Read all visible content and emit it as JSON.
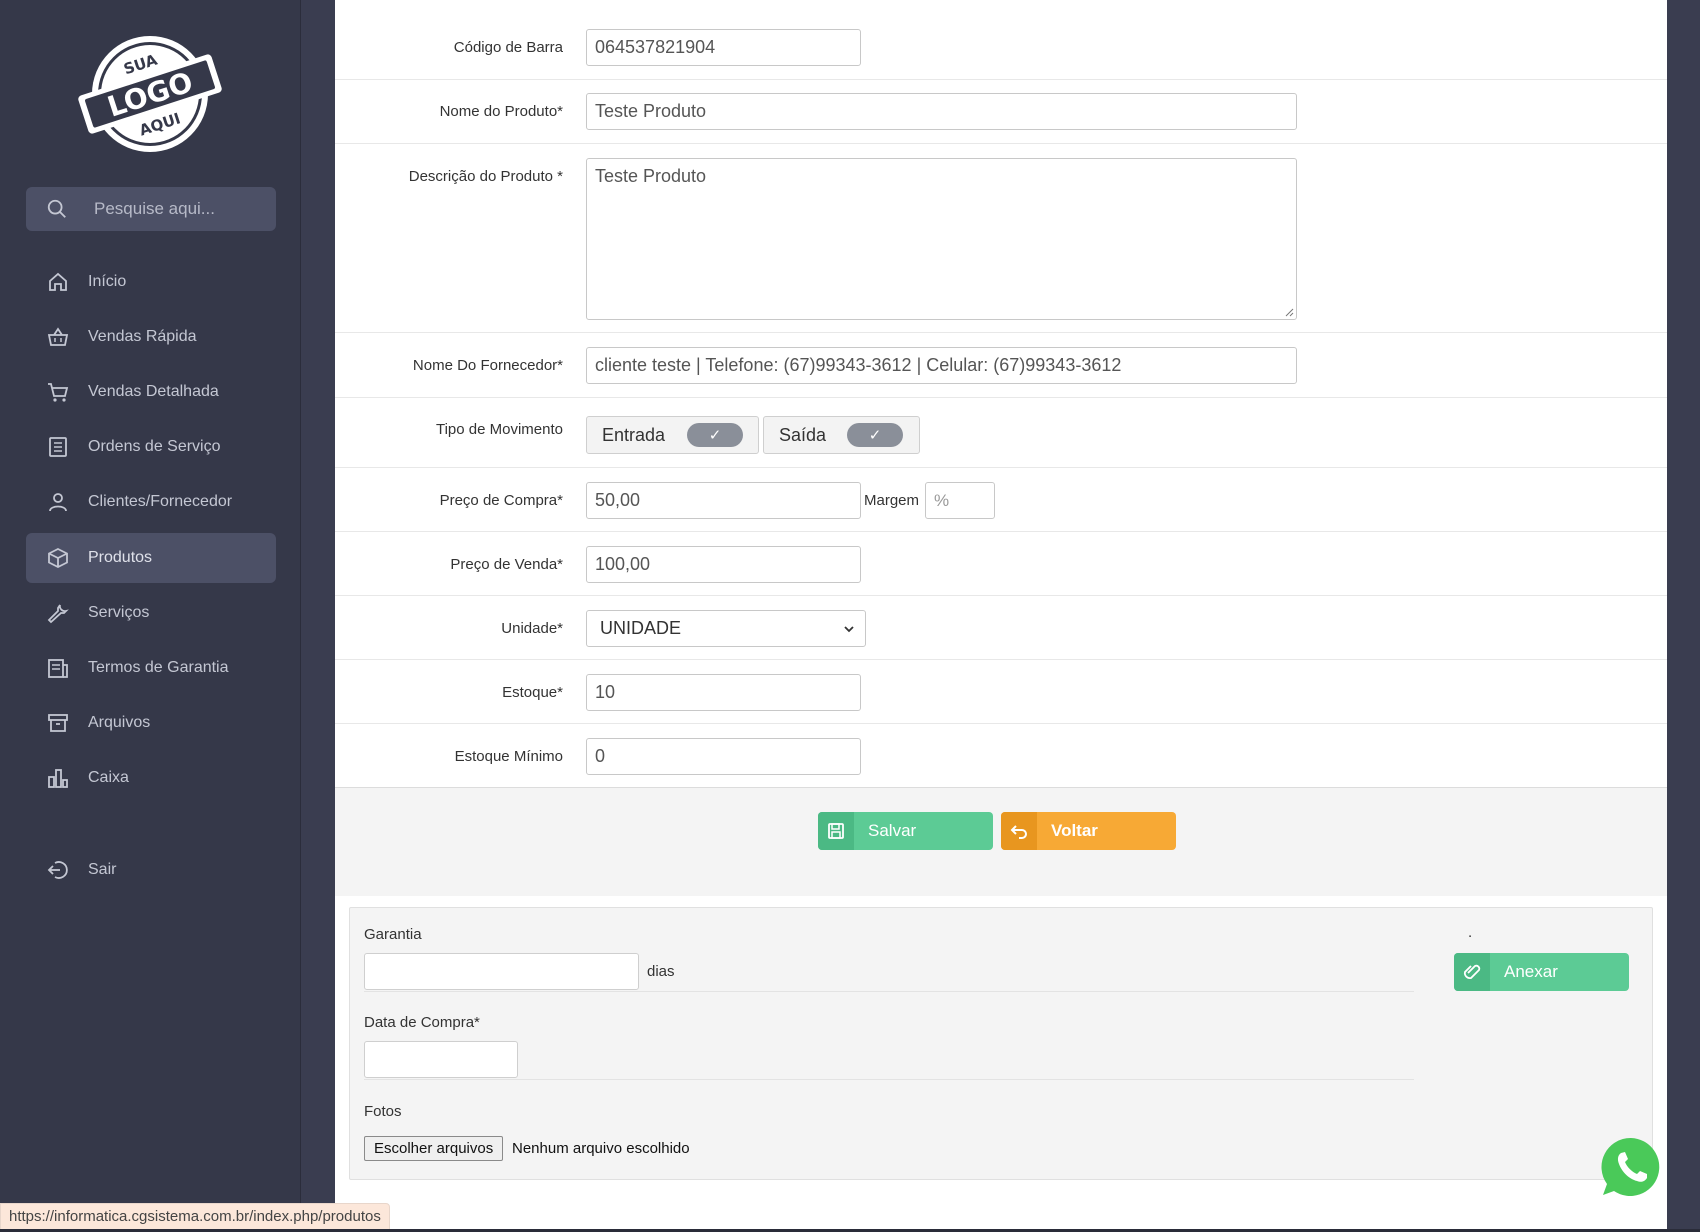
{
  "logo": {
    "line1": "SUA",
    "line2": "LOGO",
    "line3": "AQUI"
  },
  "search": {
    "placeholder": "Pesquise aqui..."
  },
  "sidebar": {
    "items": [
      {
        "label": "Início",
        "icon": "home-icon"
      },
      {
        "label": "Vendas Rápida",
        "icon": "basket-icon"
      },
      {
        "label": "Vendas Detalhada",
        "icon": "cart-icon"
      },
      {
        "label": "Ordens de Serviço",
        "icon": "list-icon"
      },
      {
        "label": "Clientes/Fornecedor",
        "icon": "user-icon"
      },
      {
        "label": "Produtos",
        "icon": "box-icon",
        "active": true
      },
      {
        "label": "Serviços",
        "icon": "wrench-icon"
      },
      {
        "label": "Termos de Garantia",
        "icon": "document-icon"
      },
      {
        "label": "Arquivos",
        "icon": "archive-icon"
      },
      {
        "label": "Caixa",
        "icon": "bar-chart-icon"
      }
    ],
    "logout": {
      "label": "Sair",
      "icon": "logout-icon"
    }
  },
  "form": {
    "barcode": {
      "label": "Código de Barra",
      "value": "064537821904"
    },
    "product_name": {
      "label": "Nome do Produto*",
      "value": "Teste Produto"
    },
    "description": {
      "label": "Descrição do Produto *",
      "value": "Teste Produto"
    },
    "supplier": {
      "label": "Nome Do Fornecedor*",
      "value": "cliente teste | Telefone: (67)99343-3612 | Celular: (67)99343-3612"
    },
    "movement": {
      "label": "Tipo de Movimento",
      "entrada": "Entrada",
      "saida": "Saída",
      "check": "✓"
    },
    "purchase_price": {
      "label": "Preço de Compra*",
      "value": "50,00"
    },
    "margin": {
      "label": "Margem",
      "placeholder": "%"
    },
    "sale_price": {
      "label": "Preço de Venda*",
      "value": "100,00"
    },
    "unit": {
      "label": "Unidade*",
      "value": "UNIDADE"
    },
    "stock": {
      "label": "Estoque*",
      "value": "10"
    },
    "min_stock": {
      "label": "Estoque Mínimo",
      "value": "0"
    }
  },
  "buttons": {
    "save": "Salvar",
    "back": "Voltar"
  },
  "warranty_panel": {
    "warranty_label": "Garantia",
    "days": "dias",
    "purchase_date_label": "Data de Compra*",
    "photos_label": "Fotos",
    "file_button": "Escolher arquivos",
    "file_status": "Nenhum arquivo escolhido",
    "dot": ".",
    "attach": "Anexar"
  },
  "status_bar": {
    "url": "https://informatica.cgsistema.com.br/index.php/produtos"
  },
  "colors": {
    "sidebar": "#353849",
    "green": "#5ccb95",
    "orange": "#f7a935",
    "whatsapp": "#4ac959"
  }
}
